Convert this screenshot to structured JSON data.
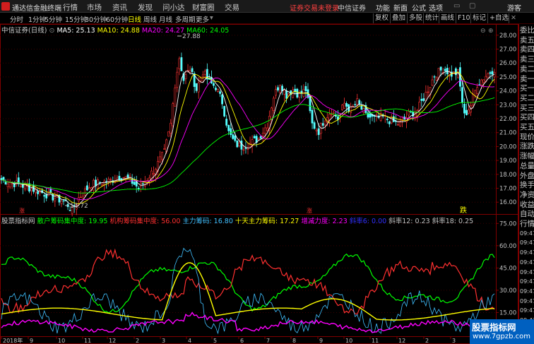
{
  "app": {
    "name": "通达信金融终端",
    "menus": [
      "行情",
      "市场",
      "资讯",
      "发现",
      "问小达",
      "财富圈",
      "交易"
    ],
    "notice": "证券交易未登录",
    "broker": "中信证券",
    "right_menus": [
      "功能",
      "新面",
      "公式",
      "选项"
    ],
    "guest": "游客"
  },
  "toolbar": {
    "periods": [
      "分时",
      "1分钟",
      "5分钟",
      "15分钟",
      "30分钟",
      "60分钟",
      "日线",
      "周线",
      "月线",
      "多周期",
      "更多"
    ],
    "active_period": "日线",
    "right_buttons": [
      "复权",
      "叠加",
      "统计",
      "画线",
      "F10",
      "标记"
    ],
    "right_buttons_b": [
      "多股",
      "+自选"
    ]
  },
  "price_panel": {
    "title": "中信证券(日线)",
    "ma": [
      {
        "label": "MA5: 25.13",
        "color": "#ffffff"
      },
      {
        "label": "MA10: 24.88",
        "color": "#ffff00"
      },
      {
        "label": "MA20: 24.27",
        "color": "#ff00ff"
      },
      {
        "label": "MA60: 24.05",
        "color": "#00ff00"
      }
    ],
    "high_label": "27.88",
    "low_label": "14.72",
    "yaxis": [
      "28.00",
      "27.00",
      "26.00",
      "25.00",
      "24.00",
      "23.00",
      "22.00",
      "21.00",
      "20.00",
      "19.00",
      "18.00",
      "17.00",
      "16.00"
    ],
    "ymin": 15.2,
    "ymax": 28.6,
    "markers": [
      "涨",
      "涨",
      "跌"
    ]
  },
  "indicator_panel": {
    "title": "股票指标网",
    "values": [
      {
        "label": "散户筹码集中度: 19.95",
        "color": "#00ff00"
      },
      {
        "label": "机构筹码集中度: 56.00",
        "color": "#ff3030"
      },
      {
        "label": "主力筹码: 16.80",
        "color": "#40c0ff"
      },
      {
        "label": "十天主力筹码: 17.27",
        "color": "#ffff00"
      },
      {
        "label": "增减力度: 2.23",
        "color": "#ff00ff"
      },
      {
        "label": "斜率6: 0.00",
        "color": "#3030ff"
      },
      {
        "label": "斜率12: 0.23",
        "color": "#c0c0c0"
      },
      {
        "label": "斜率18: 0.25",
        "color": "#c0c0c0"
      }
    ],
    "yaxis": [
      "75.00",
      "60.00",
      "45.00",
      "30.00",
      "15.00"
    ],
    "ymin": 0,
    "ymax": 78
  },
  "xaxis": [
    "2018年",
    "9",
    "10",
    "11",
    "12",
    "2",
    "3",
    "4",
    "5",
    "6",
    "7",
    "8",
    "9",
    "10",
    "11",
    "12",
    "2",
    "3",
    "4"
  ],
  "side_panel": {
    "items": [
      "委比",
      "卖五",
      "卖四",
      "卖三",
      "卖二",
      "卖一",
      "买一",
      "买二",
      "买三",
      "买四",
      "买五",
      "现价",
      "涨跌",
      "涨幅",
      "总量",
      "外盘",
      "换手",
      "净资",
      "收益",
      "自动",
      "行情",
      "09:47",
      "09:47",
      "09:47",
      "09:47",
      "09:47",
      "09:47",
      "09:47",
      "09:47",
      "09:47",
      "09:47",
      "09:47"
    ]
  },
  "watermark": {
    "line1": "股票指标网",
    "line2": "www.7gpzb.com"
  }
}
